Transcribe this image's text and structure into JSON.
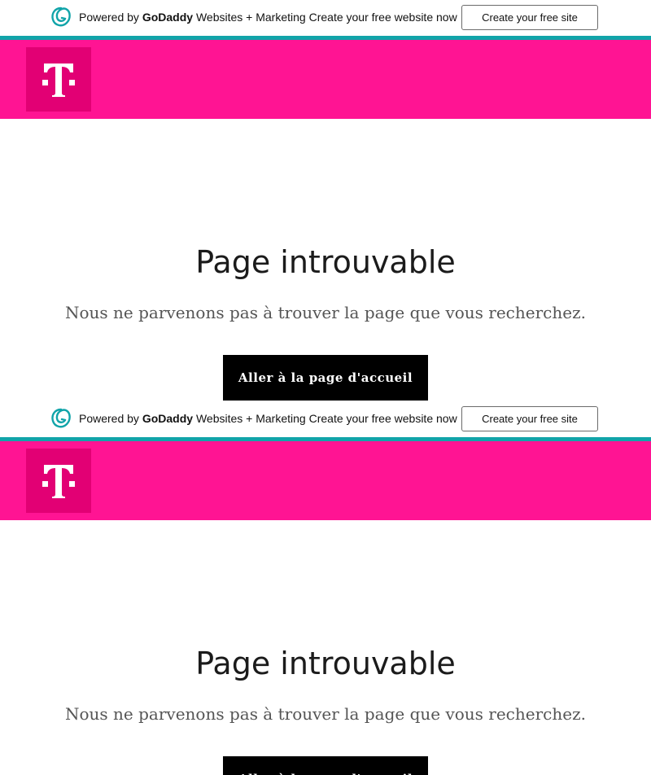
{
  "godaddy_bar": {
    "powered_by": "Powered by",
    "brand": "GoDaddy",
    "product": "Websites + Marketing",
    "promo": "Create your free website now",
    "cta_label": "Create your free site"
  },
  "header": {
    "logo_icon": "t-logo-icon",
    "brand_color": "#ff1493",
    "logo_bg_color": "#e20074",
    "accent_line_color": "#11a4a9"
  },
  "main": {
    "title": "Page introuvable",
    "message": "Nous ne parvenons pas à trouver la page que vous recherchez.",
    "home_button_label": "Aller à la page d'accueil"
  }
}
